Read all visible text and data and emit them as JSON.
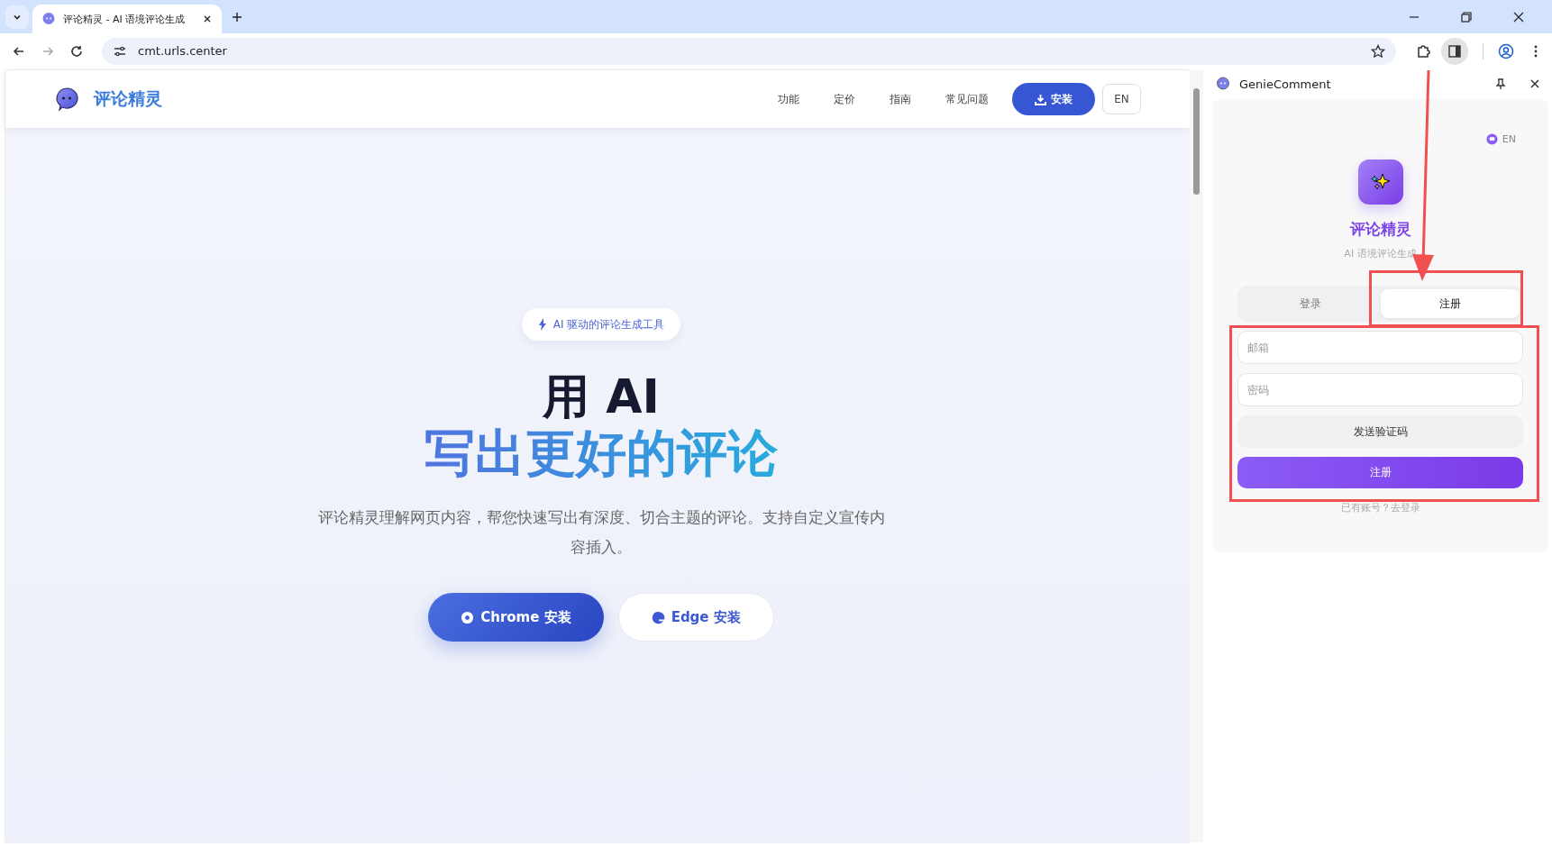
{
  "browser": {
    "tab_title": "评论精灵 - AI 语境评论生成",
    "url": "cmt.urls.center"
  },
  "site": {
    "logo_text": "评论精灵",
    "nav": [
      "功能",
      "定价",
      "指南",
      "常见问题"
    ],
    "install_button": "安装",
    "lang_button": "EN",
    "badge": "AI 驱动的评论生成工具",
    "headline_1": "用 AI",
    "headline_2": "写出更好的评论",
    "description": "评论精灵理解网页内容，帮您快速写出有深度、切合主题的评论。支持自定义宣传内容插入。",
    "buttons": [
      {
        "kind": "chrome",
        "label": "Chrome 安装"
      },
      {
        "kind": "edge",
        "label": "Edge 安装"
      }
    ]
  },
  "side_panel": {
    "title": "GenieComment",
    "lang": "EN",
    "app_name": "评论精灵",
    "subtitle": "AI 语境评论生成",
    "tabs": [
      {
        "label": "登录",
        "selected": false
      },
      {
        "label": "注册",
        "selected": true
      }
    ],
    "email": {
      "placeholder": "邮箱"
    },
    "password": {
      "placeholder": "密码"
    },
    "send_code_button": "发送验证码",
    "submit_button": "注册",
    "login_link": "已有账号？去登录"
  }
}
